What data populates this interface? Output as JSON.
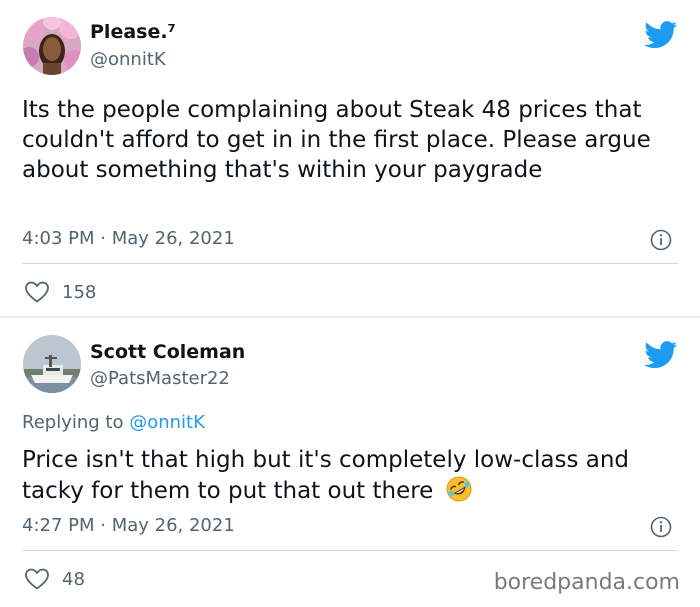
{
  "tweets": [
    {
      "display_name": "Please.⁷",
      "handle": "@onnitK",
      "text": "Its the people complaining about Steak 48 prices that couldn't afford to get in in the first place. Please argue about something that's within your paygrade",
      "timestamp": "4:03 PM · May 26, 2021",
      "likes": "158"
    },
    {
      "display_name": "Scott Coleman",
      "handle": "@PatsMaster22",
      "reply_prefix": "Replying to ",
      "reply_to": "@onnitK",
      "text": "Price isn't that high but it's completely low-class and tacky for them to put that out there",
      "emoji": "rolling-on-floor-laughing-emoji",
      "timestamp": "4:27 PM · May 26, 2021",
      "likes": "48"
    }
  ],
  "watermark": "boredpanda.com",
  "colors": {
    "twitter_blue": "#1d9bf0",
    "secondary_text": "#536471",
    "primary_text": "#0f1419"
  },
  "icons": {
    "brand": "twitter-bird-icon",
    "info": "info-icon",
    "like": "heart-outline-icon"
  }
}
